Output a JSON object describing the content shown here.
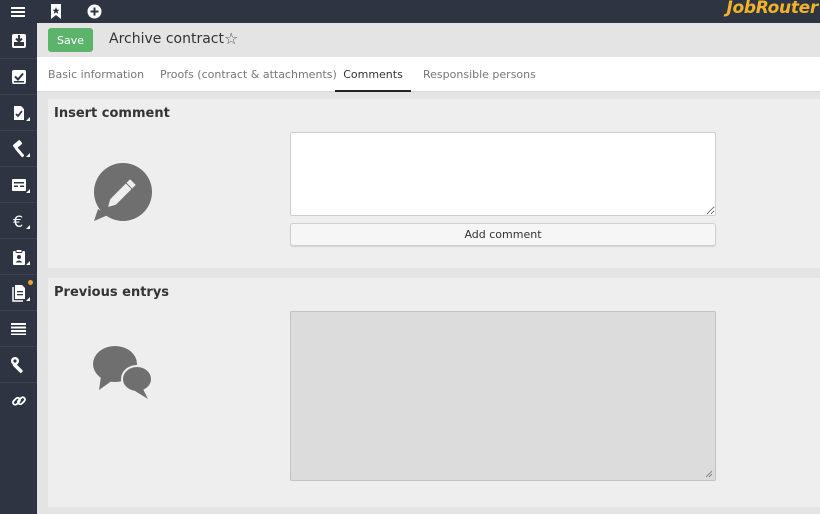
{
  "brand": "JobRouter",
  "colors": {
    "nav_bg": "#2f3443",
    "accent_brand": "#f0b429",
    "save_green": "#5cb46a",
    "notify_dot": "#f0a030"
  },
  "topbar": {
    "icons": [
      "menu-icon",
      "bookmark-star-icon",
      "add-circle-icon"
    ]
  },
  "sidebar": {
    "items": [
      {
        "icon": "inbox-download-icon"
      },
      {
        "icon": "inbox-check-icon"
      },
      {
        "icon": "document-edit-icon"
      },
      {
        "icon": "hammer-icon"
      },
      {
        "icon": "table-icon"
      },
      {
        "icon": "euro-icon"
      },
      {
        "icon": "clipboard-person-icon"
      },
      {
        "icon": "documents-icon",
        "notification": true
      },
      {
        "icon": "list-icon"
      },
      {
        "icon": "wrench-icon"
      },
      {
        "icon": "link-icon"
      }
    ]
  },
  "header": {
    "save_label": "Save",
    "title": "Archive contract",
    "favorite_icon": "star-outline-icon"
  },
  "tabs": [
    {
      "label": "Basic information"
    },
    {
      "label": "Proofs (contract & attachments)"
    },
    {
      "label": "Comments",
      "active": true
    },
    {
      "label": "Responsible persons"
    }
  ],
  "insert_comment": {
    "title": "Insert comment",
    "icon": "speech-pencil-icon",
    "textarea_value": "",
    "button_label": "Add comment"
  },
  "previous_entries": {
    "title": "Previous entrys",
    "icon": "speech-bubbles-icon",
    "value": ""
  }
}
